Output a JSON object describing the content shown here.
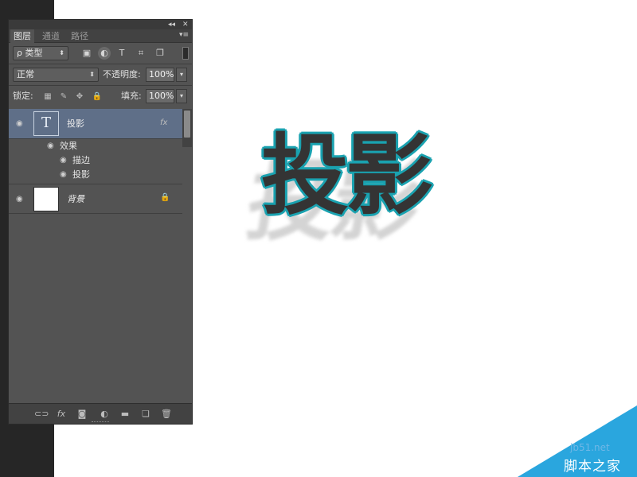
{
  "panel": {
    "controls": {
      "collapse": "◂◂",
      "close": "✕"
    },
    "tabs": [
      {
        "label": "图层",
        "active": true
      },
      {
        "label": "通道",
        "active": false
      },
      {
        "label": "路径",
        "active": false
      }
    ],
    "menu_icon": "panel-menu-icon",
    "filter": {
      "label": "ρ 类型",
      "icons": [
        "image-filter-icon",
        "adjustment-filter-icon",
        "text-filter-icon",
        "shape-filter-icon",
        "smart-object-filter-icon"
      ]
    },
    "blend_mode": "正常",
    "opacity_label": "不透明度:",
    "opacity_value": "100%",
    "lock_label": "锁定:",
    "fill_label": "填充:",
    "fill_value": "100%",
    "layers": [
      {
        "name": "投影",
        "kind": "text",
        "thumb_glyph": "T",
        "selected": true,
        "fx_badge": "fx",
        "effects_label": "效果",
        "effects": [
          "描边",
          "投影"
        ]
      },
      {
        "name": "背景",
        "kind": "background",
        "selected": false,
        "locked": true
      }
    ],
    "bottom_icons": [
      "link-layers-icon",
      "fx-icon",
      "mask-icon",
      "adjustment-layer-icon",
      "folder-icon",
      "new-layer-icon",
      "trash-icon"
    ]
  },
  "canvas": {
    "artwork_text": "投影",
    "stroke_color": "#1aa2b0",
    "fill_color": "#343434"
  },
  "watermark": {
    "site": "jb51.net",
    "name": "脚本之家",
    "color": "#2aa6de"
  }
}
